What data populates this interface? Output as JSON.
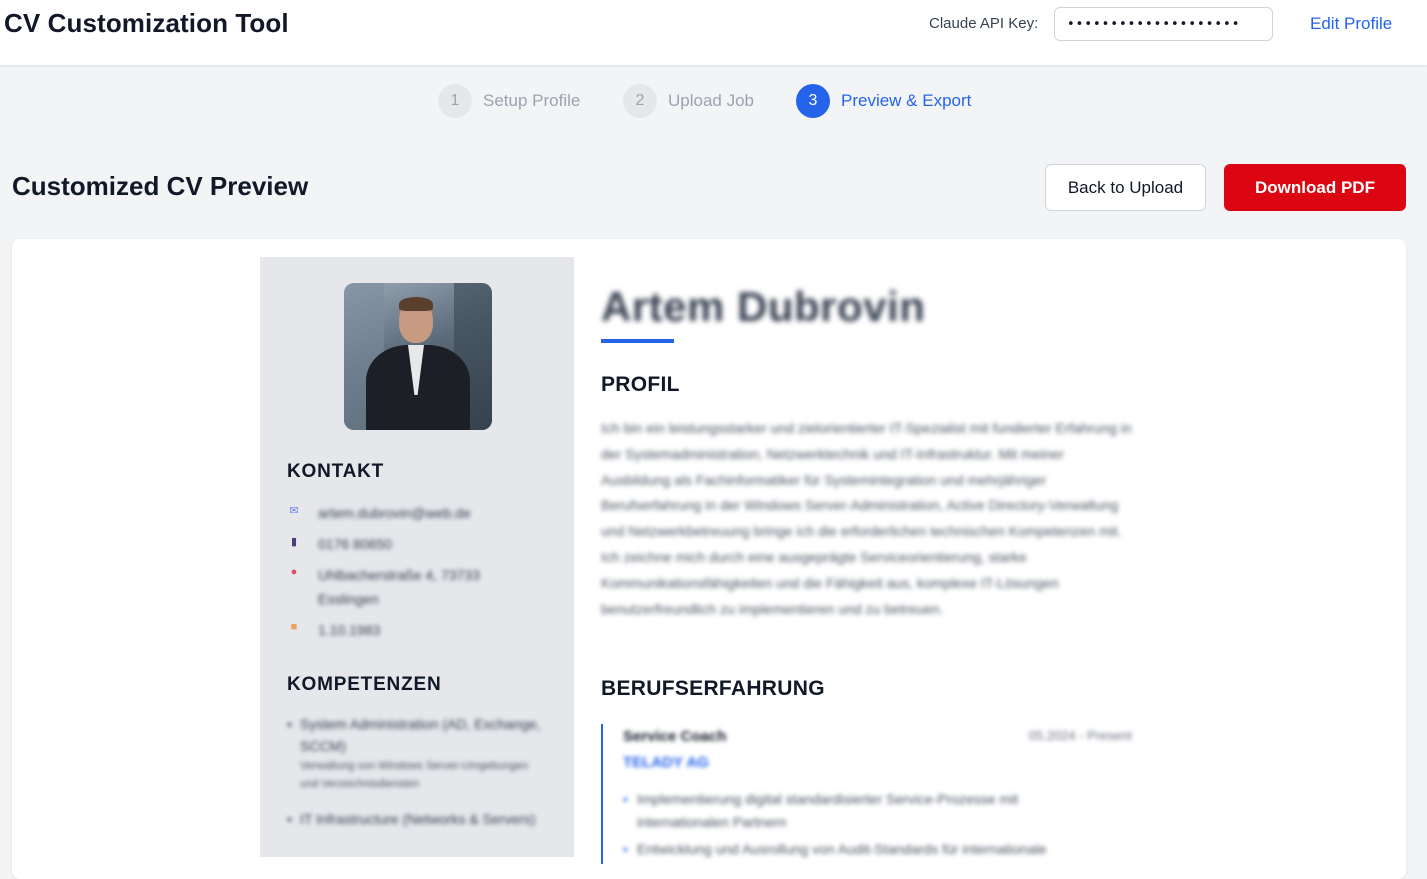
{
  "header": {
    "app_title": "CV Customization Tool",
    "api_key_label": "Claude API Key:",
    "api_key_value": "••••••••••••••••••••",
    "edit_profile_label": "Edit Profile"
  },
  "stepper": {
    "steps": [
      {
        "number": "1",
        "label": "Setup Profile",
        "state": "inactive"
      },
      {
        "number": "2",
        "label": "Upload Job",
        "state": "inactive"
      },
      {
        "number": "3",
        "label": "Preview & Export",
        "state": "active"
      }
    ]
  },
  "preview": {
    "title": "Customized CV Preview",
    "back_label": "Back to Upload",
    "download_label": "Download PDF"
  },
  "cv": {
    "name": "Artem Dubrovin",
    "sidebar": {
      "contact_heading": "KONTAKT",
      "contact": [
        {
          "icon": "email-icon",
          "text": "artem.dubrovin@web.de"
        },
        {
          "icon": "phone-icon",
          "text": "0176 80650"
        },
        {
          "icon": "location-icon",
          "text": "Uhlbacherstraße 4, 73733 Esslingen"
        },
        {
          "icon": "calendar-icon",
          "text": "1.10.1983"
        }
      ],
      "skills_heading": "KOMPETENZEN",
      "skills": [
        {
          "title": "System Administration (AD, Exchange, SCCM)",
          "sub": "Verwaltung von Windows Server-Umgebungen und Verzeichnisdiensten"
        },
        {
          "title": "IT Infrastructure (Networks & Servers)",
          "sub": ""
        }
      ]
    },
    "profile_heading": "PROFIL",
    "profile_text": "Ich bin ein leistungsstarker und zielorientierter IT-Spezialist mit fundierter Erfahrung in der Systemadministration, Netzwerktechnik und IT-Infrastruktur. Mit meiner Ausbildung als Fachinformatiker für Systemintegration und mehrjähriger Berufserfahrung in der Windows Server-Administration, Active Directory-Verwaltung und Netzwerkbetreuung bringe ich die erforderlichen technischen Kompetenzen mit. Ich zeichne mich durch eine ausgeprägte Serviceorientierung, starke Kommunikationsfähigkeiten und die Fähigkeit aus, komplexe IT-Lösungen benutzerfreundlich zu implementieren und zu betreuen.",
    "experience_heading": "BERUFSERFAHRUNG",
    "jobs": [
      {
        "title": "Service Coach",
        "date": "05.2024 - Present",
        "company": "TELADY AG",
        "bullets": [
          "Implementierung digital standardisierter Service-Prozesse mit internationalen Partnern",
          "Entwicklung und Ausrollung von Audit-Standards für internationale"
        ]
      }
    ]
  },
  "colors": {
    "accent": "#2563eb",
    "danger": "#dc0613",
    "sidebar_bg": "#e5e7eb"
  }
}
